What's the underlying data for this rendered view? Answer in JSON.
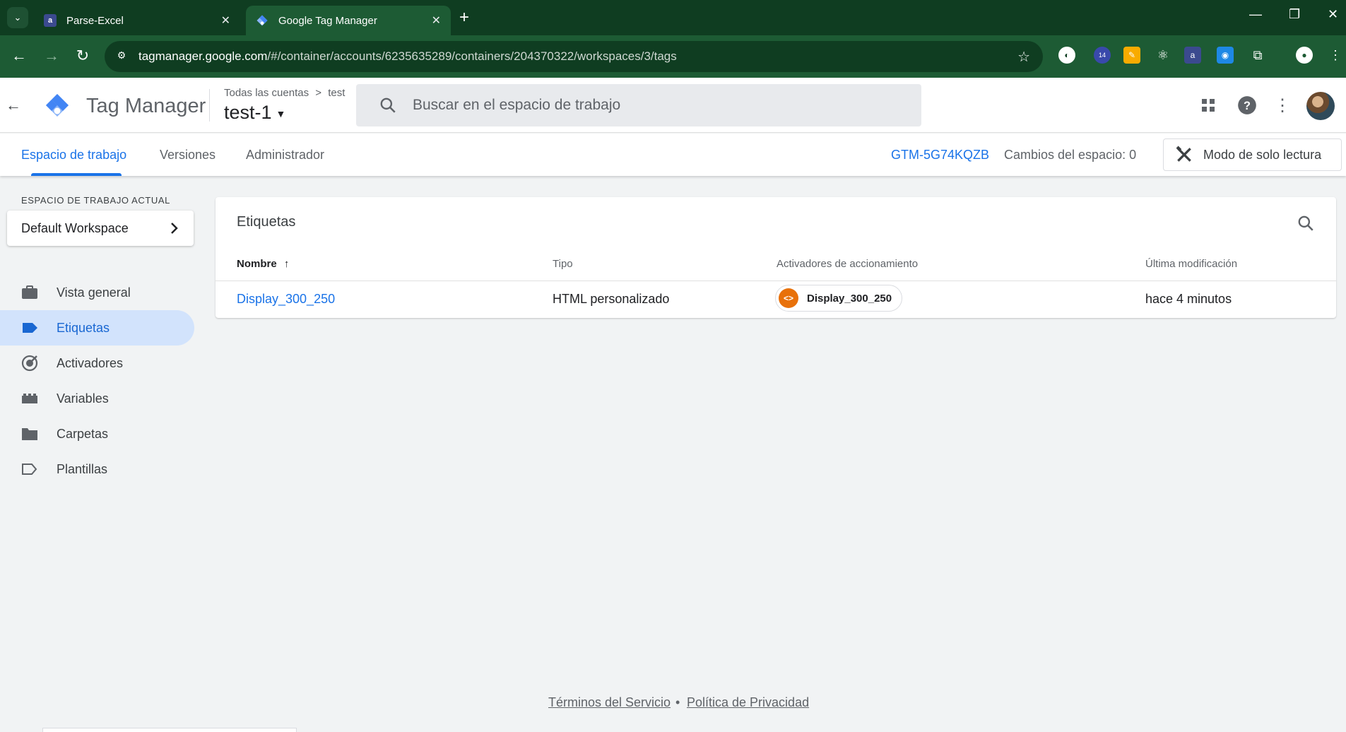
{
  "browser": {
    "tabs": [
      {
        "title": "Parse-Excel",
        "active": false
      },
      {
        "title": "Google Tag Manager",
        "active": true
      }
    ],
    "url_host": "tagmanager.google.com",
    "url_path": "/#/container/accounts/6235635289/containers/204370322/workspaces/3/tags",
    "extension_badge": "14"
  },
  "header": {
    "product": "Tag Manager",
    "breadcrumb_account": "Todas las cuentas",
    "breadcrumb_sep": ">",
    "breadcrumb_container": "test",
    "container": "test-1",
    "search_placeholder": "Buscar en el espacio de trabajo"
  },
  "subnav": {
    "tabs": [
      "Espacio de trabajo",
      "Versiones",
      "Administrador"
    ],
    "active_tab": "Espacio de trabajo",
    "container_id": "GTM-5G74KQZB",
    "workspace_changes": "Cambios del espacio: 0",
    "mode_button": "Modo de solo lectura"
  },
  "sidebar": {
    "section_label": "ESPACIO DE TRABAJO ACTUAL",
    "workspace": "Default Workspace",
    "items": [
      {
        "label": "Vista general",
        "icon": "briefcase-icon"
      },
      {
        "label": "Etiquetas",
        "icon": "tag-icon",
        "active": true
      },
      {
        "label": "Activadores",
        "icon": "trigger-icon"
      },
      {
        "label": "Variables",
        "icon": "variables-icon"
      },
      {
        "label": "Carpetas",
        "icon": "folder-icon"
      },
      {
        "label": "Plantillas",
        "icon": "template-icon"
      }
    ]
  },
  "tags": {
    "title": "Etiquetas",
    "columns": [
      "Nombre",
      "Tipo",
      "Activadores de accionamiento",
      "Última modificación"
    ],
    "sort_indicator": "↑",
    "rows": [
      {
        "name": "Display_300_250",
        "type": "HTML personalizado",
        "trigger": "Display_300_250",
        "modified": "hace 4 minutos"
      }
    ]
  },
  "footer": {
    "terms": "Términos del Servicio",
    "separator": "•",
    "privacy": "Política de Privacidad"
  },
  "colors": {
    "accent": "#1a73e8",
    "chrome_dark": "#0f3d21",
    "chrome": "#1d5b34",
    "trigger_orange": "#e8710a"
  }
}
